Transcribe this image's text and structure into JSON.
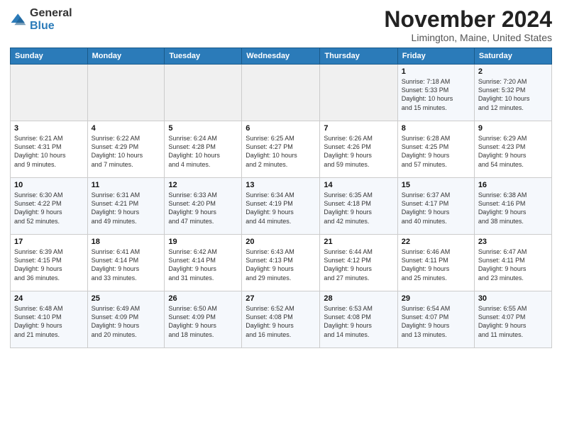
{
  "logo": {
    "general": "General",
    "blue": "Blue"
  },
  "header": {
    "month": "November 2024",
    "location": "Limington, Maine, United States"
  },
  "columns": [
    "Sunday",
    "Monday",
    "Tuesday",
    "Wednesday",
    "Thursday",
    "Friday",
    "Saturday"
  ],
  "weeks": [
    [
      {
        "day": "",
        "info": ""
      },
      {
        "day": "",
        "info": ""
      },
      {
        "day": "",
        "info": ""
      },
      {
        "day": "",
        "info": ""
      },
      {
        "day": "",
        "info": ""
      },
      {
        "day": "1",
        "info": "Sunrise: 7:18 AM\nSunset: 5:33 PM\nDaylight: 10 hours\nand 15 minutes."
      },
      {
        "day": "2",
        "info": "Sunrise: 7:20 AM\nSunset: 5:32 PM\nDaylight: 10 hours\nand 12 minutes."
      }
    ],
    [
      {
        "day": "3",
        "info": "Sunrise: 6:21 AM\nSunset: 4:31 PM\nDaylight: 10 hours\nand 9 minutes."
      },
      {
        "day": "4",
        "info": "Sunrise: 6:22 AM\nSunset: 4:29 PM\nDaylight: 10 hours\nand 7 minutes."
      },
      {
        "day": "5",
        "info": "Sunrise: 6:24 AM\nSunset: 4:28 PM\nDaylight: 10 hours\nand 4 minutes."
      },
      {
        "day": "6",
        "info": "Sunrise: 6:25 AM\nSunset: 4:27 PM\nDaylight: 10 hours\nand 2 minutes."
      },
      {
        "day": "7",
        "info": "Sunrise: 6:26 AM\nSunset: 4:26 PM\nDaylight: 9 hours\nand 59 minutes."
      },
      {
        "day": "8",
        "info": "Sunrise: 6:28 AM\nSunset: 4:25 PM\nDaylight: 9 hours\nand 57 minutes."
      },
      {
        "day": "9",
        "info": "Sunrise: 6:29 AM\nSunset: 4:23 PM\nDaylight: 9 hours\nand 54 minutes."
      }
    ],
    [
      {
        "day": "10",
        "info": "Sunrise: 6:30 AM\nSunset: 4:22 PM\nDaylight: 9 hours\nand 52 minutes."
      },
      {
        "day": "11",
        "info": "Sunrise: 6:31 AM\nSunset: 4:21 PM\nDaylight: 9 hours\nand 49 minutes."
      },
      {
        "day": "12",
        "info": "Sunrise: 6:33 AM\nSunset: 4:20 PM\nDaylight: 9 hours\nand 47 minutes."
      },
      {
        "day": "13",
        "info": "Sunrise: 6:34 AM\nSunset: 4:19 PM\nDaylight: 9 hours\nand 44 minutes."
      },
      {
        "day": "14",
        "info": "Sunrise: 6:35 AM\nSunset: 4:18 PM\nDaylight: 9 hours\nand 42 minutes."
      },
      {
        "day": "15",
        "info": "Sunrise: 6:37 AM\nSunset: 4:17 PM\nDaylight: 9 hours\nand 40 minutes."
      },
      {
        "day": "16",
        "info": "Sunrise: 6:38 AM\nSunset: 4:16 PM\nDaylight: 9 hours\nand 38 minutes."
      }
    ],
    [
      {
        "day": "17",
        "info": "Sunrise: 6:39 AM\nSunset: 4:15 PM\nDaylight: 9 hours\nand 36 minutes."
      },
      {
        "day": "18",
        "info": "Sunrise: 6:41 AM\nSunset: 4:14 PM\nDaylight: 9 hours\nand 33 minutes."
      },
      {
        "day": "19",
        "info": "Sunrise: 6:42 AM\nSunset: 4:14 PM\nDaylight: 9 hours\nand 31 minutes."
      },
      {
        "day": "20",
        "info": "Sunrise: 6:43 AM\nSunset: 4:13 PM\nDaylight: 9 hours\nand 29 minutes."
      },
      {
        "day": "21",
        "info": "Sunrise: 6:44 AM\nSunset: 4:12 PM\nDaylight: 9 hours\nand 27 minutes."
      },
      {
        "day": "22",
        "info": "Sunrise: 6:46 AM\nSunset: 4:11 PM\nDaylight: 9 hours\nand 25 minutes."
      },
      {
        "day": "23",
        "info": "Sunrise: 6:47 AM\nSunset: 4:11 PM\nDaylight: 9 hours\nand 23 minutes."
      }
    ],
    [
      {
        "day": "24",
        "info": "Sunrise: 6:48 AM\nSunset: 4:10 PM\nDaylight: 9 hours\nand 21 minutes."
      },
      {
        "day": "25",
        "info": "Sunrise: 6:49 AM\nSunset: 4:09 PM\nDaylight: 9 hours\nand 20 minutes."
      },
      {
        "day": "26",
        "info": "Sunrise: 6:50 AM\nSunset: 4:09 PM\nDaylight: 9 hours\nand 18 minutes."
      },
      {
        "day": "27",
        "info": "Sunrise: 6:52 AM\nSunset: 4:08 PM\nDaylight: 9 hours\nand 16 minutes."
      },
      {
        "day": "28",
        "info": "Sunrise: 6:53 AM\nSunset: 4:08 PM\nDaylight: 9 hours\nand 14 minutes."
      },
      {
        "day": "29",
        "info": "Sunrise: 6:54 AM\nSunset: 4:07 PM\nDaylight: 9 hours\nand 13 minutes."
      },
      {
        "day": "30",
        "info": "Sunrise: 6:55 AM\nSunset: 4:07 PM\nDaylight: 9 hours\nand 11 minutes."
      }
    ]
  ]
}
